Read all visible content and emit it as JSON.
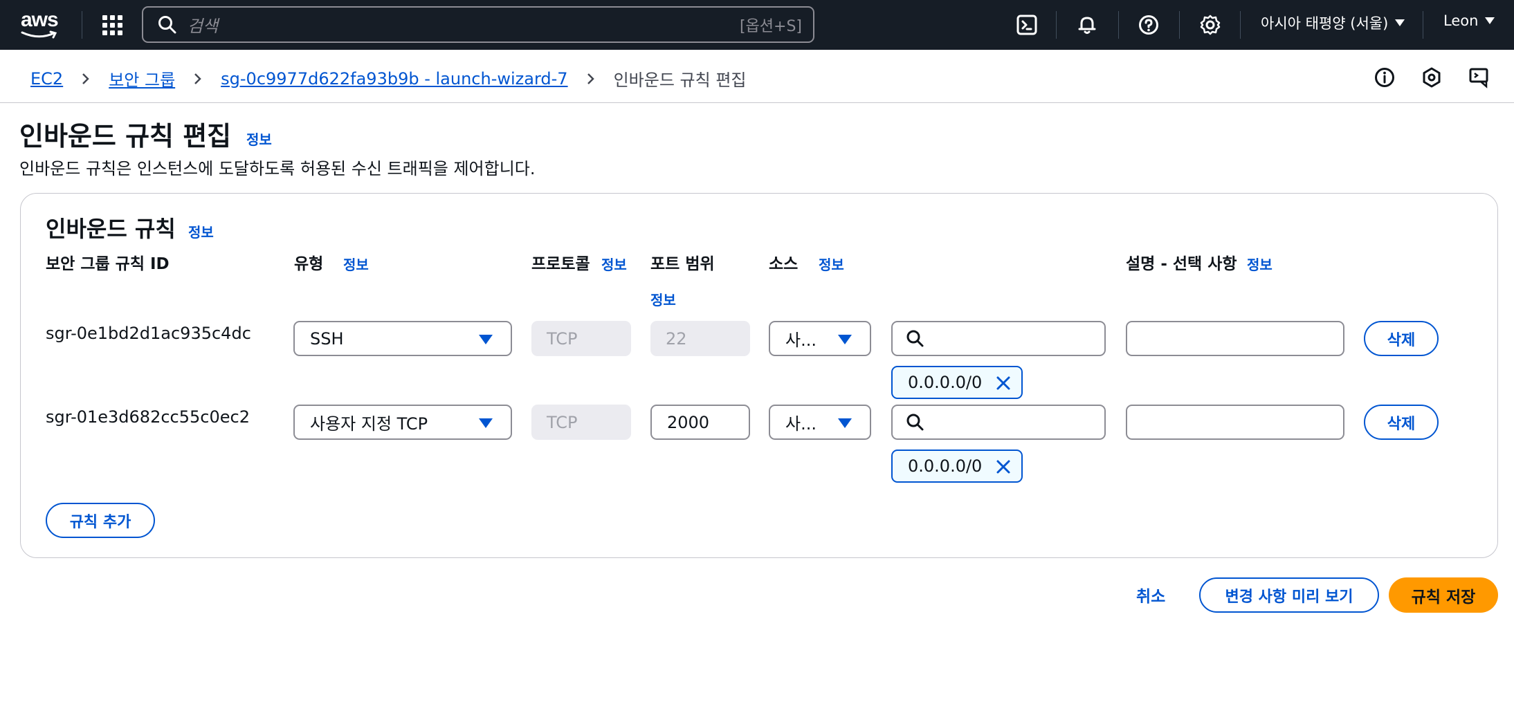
{
  "nav": {
    "logo": "aws",
    "search_placeholder": "검색",
    "search_shortcut": "[옵션+S]",
    "region": "아시아 태평양 (서울)",
    "user": "Leon"
  },
  "breadcrumb": {
    "items": [
      "EC2",
      "보안 그룹",
      "sg-0c9977d622fa93b9b - launch-wizard-7"
    ],
    "current": "인바운드 규칙 편집"
  },
  "page": {
    "title": "인바운드 규칙 편집",
    "info": "정보",
    "description": "인바운드 규칙은 인스턴스에 도달하도록 허용된 수신 트래픽을 제어합니다."
  },
  "panel": {
    "title": "인바운드 규칙",
    "info": "정보",
    "columns": {
      "id": "보안 그룹 규칙 ID",
      "type": "유형",
      "protocol": "프로토콜",
      "port": "포트 범위",
      "source": "소스",
      "description": "설명 - 선택 사항"
    },
    "rules": [
      {
        "id": "sgr-0e1bd2d1ac935c4dc",
        "type": "SSH",
        "protocol": "TCP",
        "port": "22",
        "source": "사...",
        "cidr": "0.0.0.0/0",
        "description": "",
        "delete": "삭제"
      },
      {
        "id": "sgr-01e3d682cc55c0ec2",
        "type": "사용자 지정 TCP",
        "protocol": "TCP",
        "port": "2000",
        "source": "사...",
        "cidr": "0.0.0.0/0",
        "description": "",
        "delete": "삭제"
      }
    ],
    "add_rule": "규칙 추가"
  },
  "footer": {
    "cancel": "취소",
    "preview": "변경 사항 미리 보기",
    "save": "규칙 저장"
  },
  "colors": {
    "nav_bg": "#161d26",
    "link": "#0055d1",
    "primary": "#ff9900"
  }
}
